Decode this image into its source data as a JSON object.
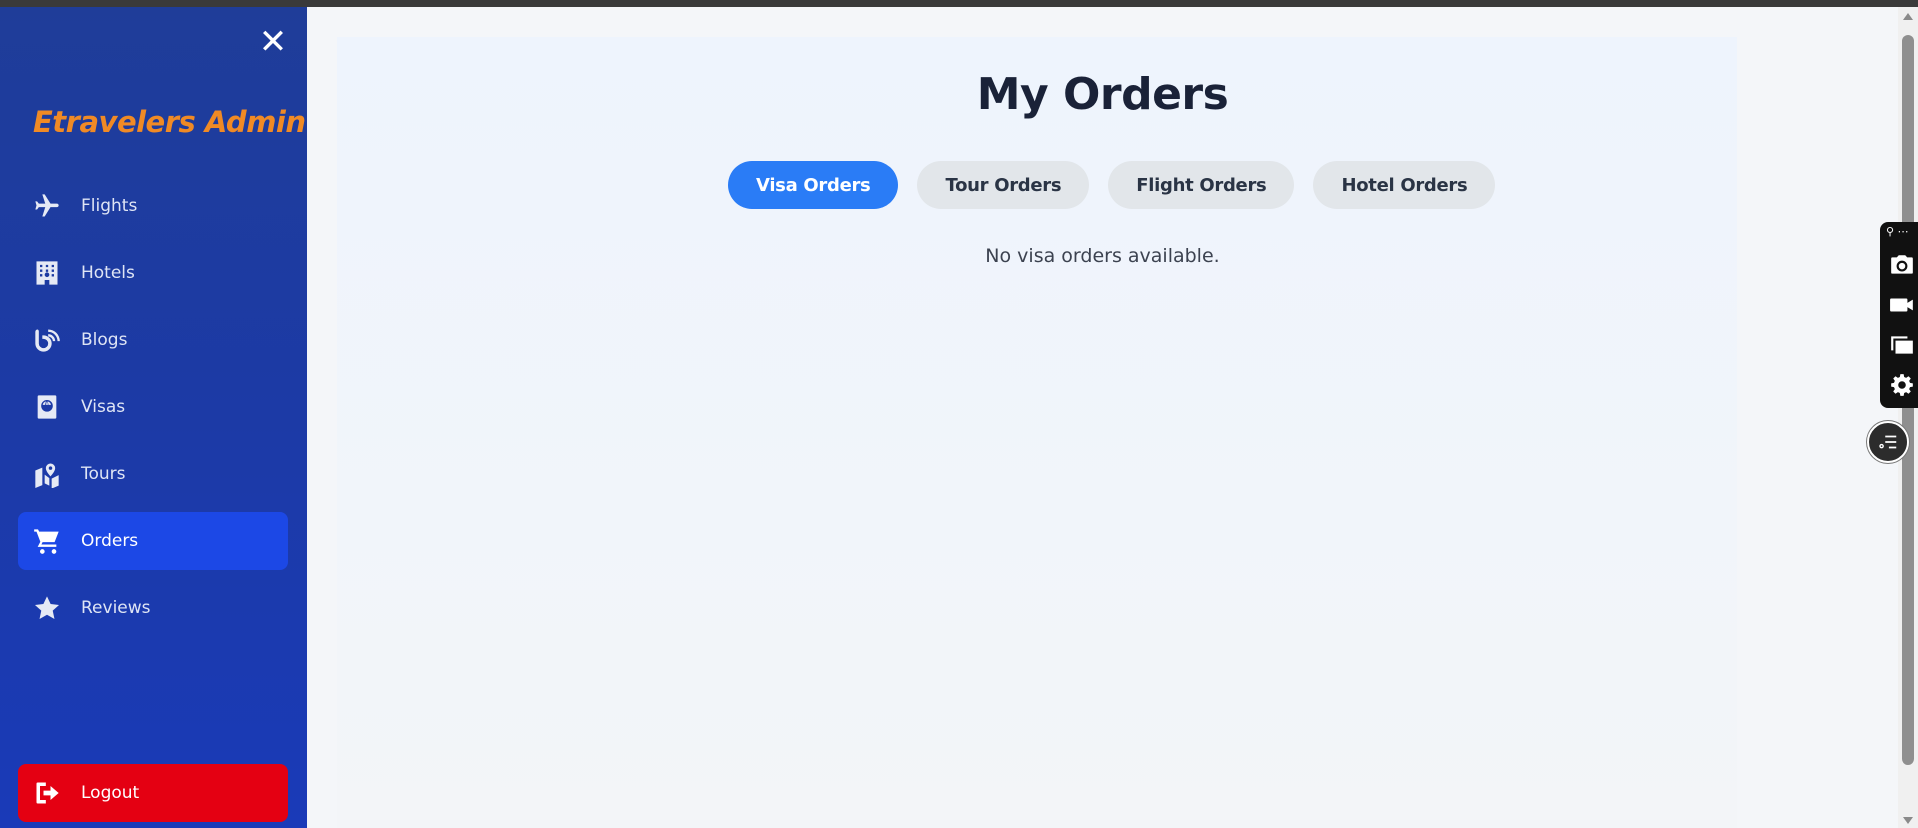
{
  "sidebar": {
    "brand": "Etravelers Admin",
    "items": [
      {
        "label": "Flights",
        "icon": "plane-icon"
      },
      {
        "label": "Hotels",
        "icon": "hotel-icon"
      },
      {
        "label": "Blogs",
        "icon": "blog-icon"
      },
      {
        "label": "Visas",
        "icon": "passport-icon"
      },
      {
        "label": "Tours",
        "icon": "map-icon"
      },
      {
        "label": "Orders",
        "icon": "cart-icon",
        "active": true
      },
      {
        "label": "Reviews",
        "icon": "star-icon"
      }
    ],
    "logout_label": "Logout"
  },
  "main": {
    "title": "My Orders",
    "tabs": [
      {
        "label": "Visa Orders",
        "active": true
      },
      {
        "label": "Tour Orders"
      },
      {
        "label": "Flight Orders"
      },
      {
        "label": "Hotel Orders"
      }
    ],
    "empty_message": "No visa orders available."
  },
  "colors": {
    "sidebar": "#1c3aa6",
    "brand": "#f08a25",
    "active_nav": "#1c48e6",
    "logout": "#e40012",
    "active_tab": "#2a7cf6",
    "tab": "#e2e6ea"
  }
}
